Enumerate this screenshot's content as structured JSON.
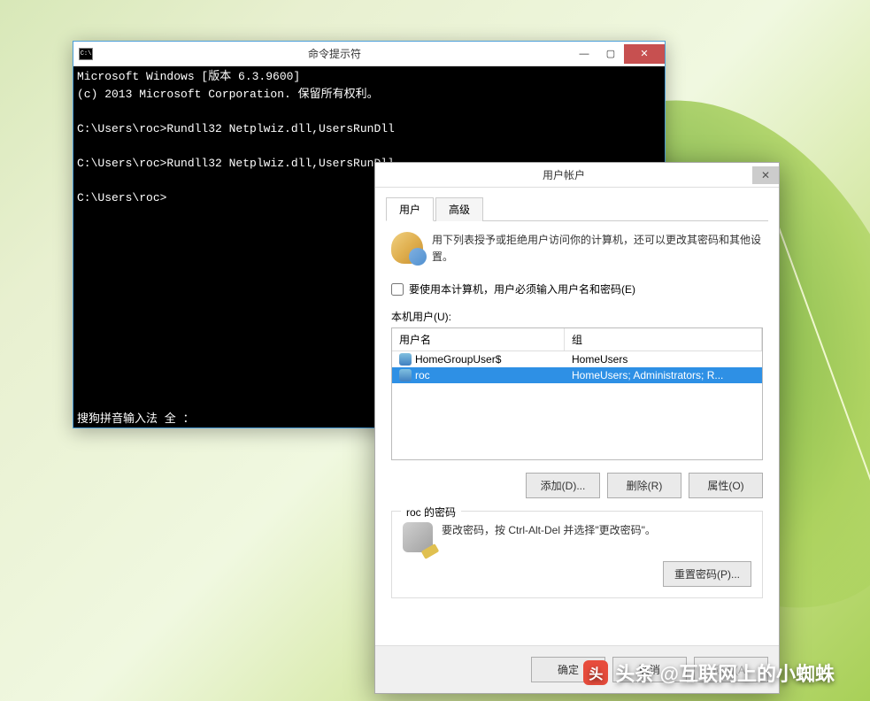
{
  "cmd": {
    "title": "命令提示符",
    "icon_label": "C:\\",
    "lines": [
      "Microsoft Windows [版本 6.3.9600]",
      "(c) 2013 Microsoft Corporation. 保留所有权利。",
      "",
      "C:\\Users\\roc>Rundll32 Netplwiz.dll,UsersRunDll",
      "",
      "C:\\Users\\roc>Rundll32 Netplwiz.dll,UsersRunDll",
      "",
      "C:\\Users\\roc>"
    ],
    "status": "搜狗拼音输入法 全 ："
  },
  "win_controls": {
    "min": "—",
    "max": "▢",
    "close": "✕"
  },
  "ua": {
    "title": "用户帐户",
    "close": "✕",
    "tabs": {
      "users": "用户",
      "advanced": "高级"
    },
    "info": "用下列表授予或拒绝用户访问你的计算机，还可以更改其密码和其他设置。",
    "require_checkbox": "要使用本计算机，用户必须输入用户名和密码(E)",
    "list_label": "本机用户(U):",
    "columns": {
      "user": "用户名",
      "group": "组"
    },
    "rows": [
      {
        "user": "HomeGroupUser$",
        "group": "HomeUsers",
        "selected": false
      },
      {
        "user": "roc",
        "group": "HomeUsers; Administrators; R...",
        "selected": true
      }
    ],
    "buttons": {
      "add": "添加(D)...",
      "remove": "删除(R)",
      "props": "属性(O)"
    },
    "pw_section": {
      "legend": "roc 的密码",
      "text": "要改密码，按 Ctrl-Alt-Del 并选择\"更改密码\"。",
      "reset": "重置密码(P)..."
    },
    "bottom": {
      "ok": "确定",
      "cancel": "取消",
      "apply": "应用(A)"
    }
  },
  "watermark": {
    "icon": "头",
    "text": "头条 @互联网上的小蜘蛛"
  }
}
